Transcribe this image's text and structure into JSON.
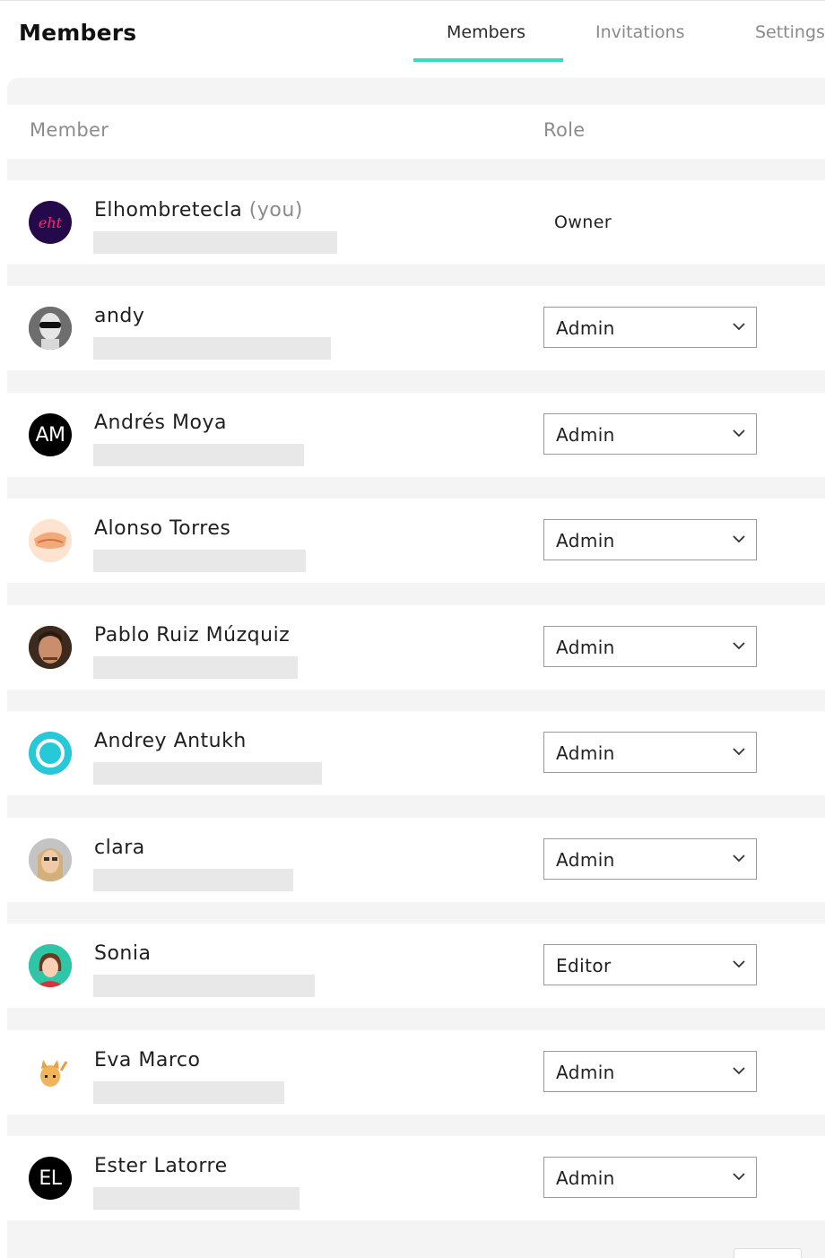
{
  "header": {
    "title": "Members",
    "tabs": [
      {
        "label": "Members",
        "active": true
      },
      {
        "label": "Invitations",
        "active": false
      },
      {
        "label": "Settings",
        "active": false
      }
    ]
  },
  "table": {
    "columns": {
      "member": "Member",
      "role": "Role"
    },
    "rows": [
      {
        "name": "Elhombretecla",
        "you_label": "(you)",
        "role": "Owner",
        "avatar_text": "eht",
        "avatar": "logo-avatar"
      },
      {
        "name": "andy",
        "role": "Admin",
        "avatar": "photo-avatar"
      },
      {
        "name": "Andrés Moya",
        "role": "Admin",
        "avatar_text": "AM",
        "avatar": "initials-avatar"
      },
      {
        "name": "Alonso Torres",
        "role": "Admin",
        "avatar": "illustration-avatar"
      },
      {
        "name": "Pablo Ruiz Múzquiz",
        "role": "Admin",
        "avatar": "photo-avatar"
      },
      {
        "name": "Andrey Antukh",
        "role": "Admin",
        "avatar": "ring-avatar"
      },
      {
        "name": "clara",
        "role": "Admin",
        "avatar": "photo-avatar"
      },
      {
        "name": "Sonia",
        "role": "Editor",
        "avatar": "illustration-avatar"
      },
      {
        "name": "Eva Marco",
        "role": "Admin",
        "avatar": "cat-avatar"
      },
      {
        "name": "Ester Latorre",
        "role": "Admin",
        "avatar_text": "EL",
        "avatar": "initials-avatar"
      }
    ]
  },
  "colors": {
    "accent": "#31e0c0",
    "panel_bg": "#f4f4f4",
    "placeholder": "#e8e8e8"
  }
}
